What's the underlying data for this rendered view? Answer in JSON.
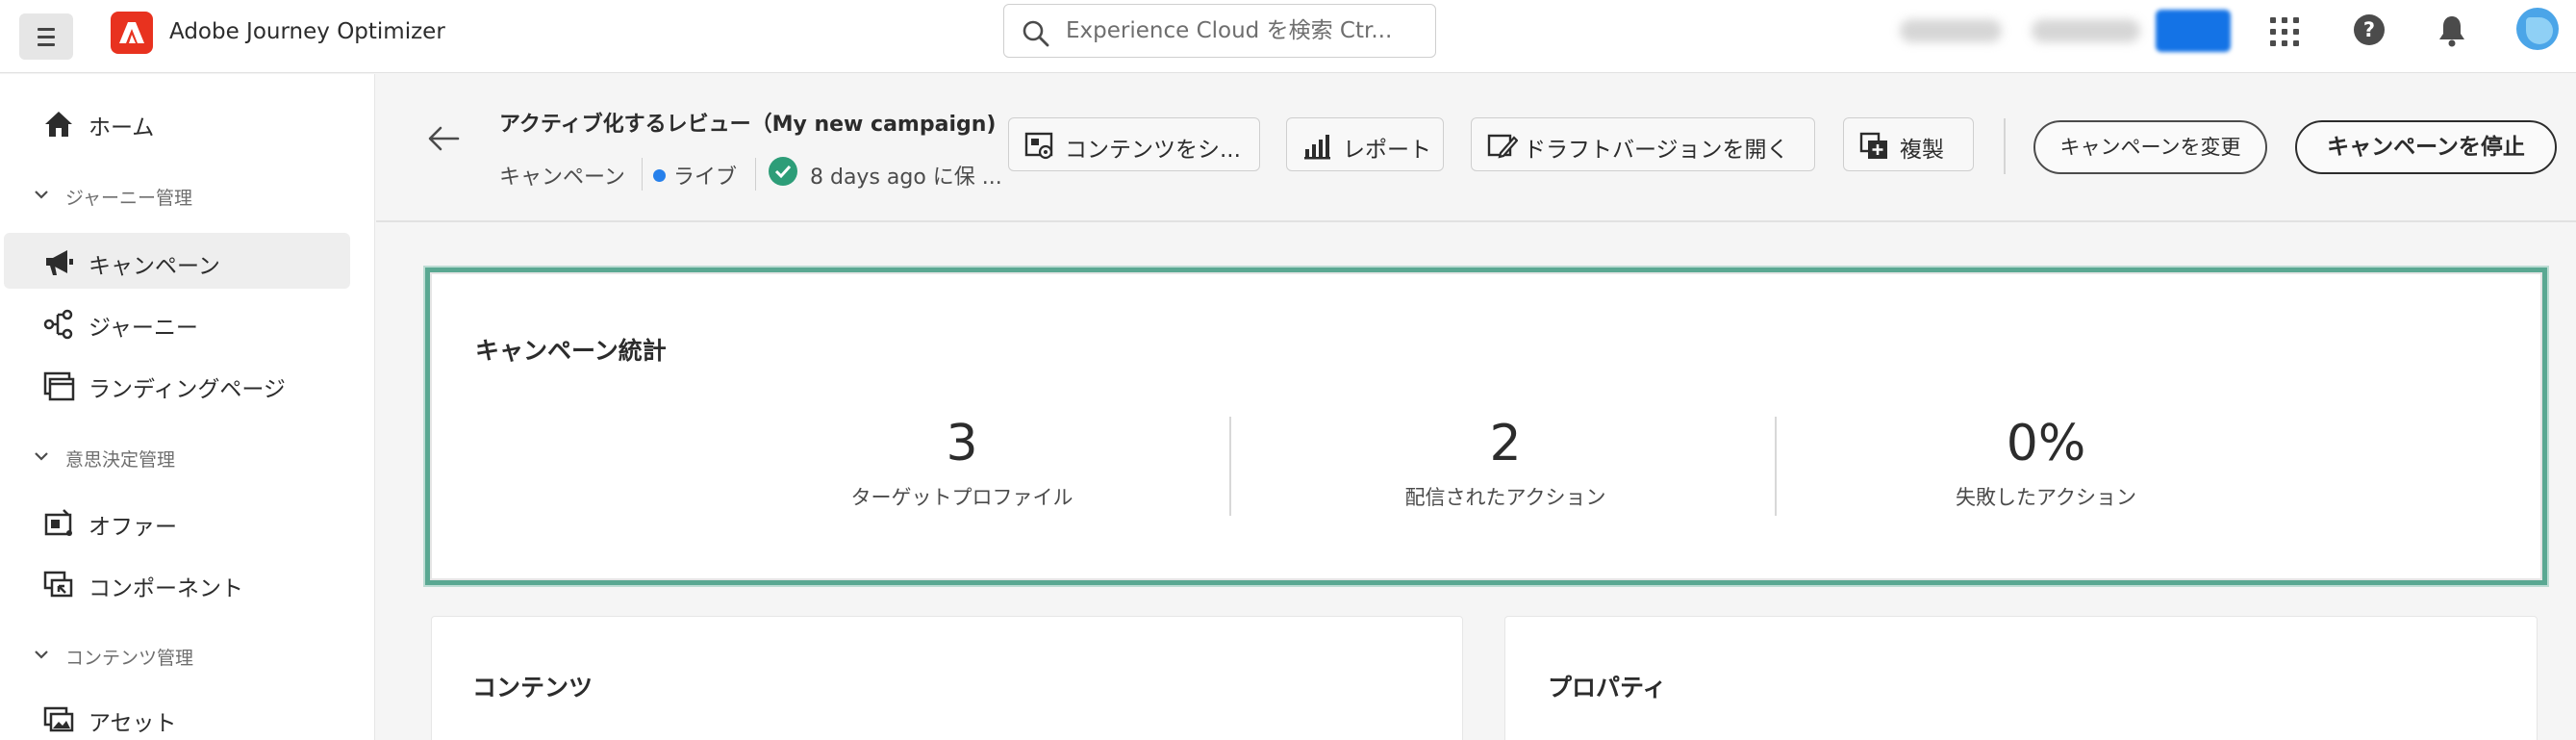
{
  "app": {
    "title": "Adobe Journey Optimizer",
    "search_placeholder": "Experience Cloud を検索 Ctr..."
  },
  "sidebar": {
    "items": [
      {
        "label": "ホーム",
        "icon": "home-icon"
      },
      {
        "group": "ジャーニー管理"
      },
      {
        "label": "キャンペーン",
        "icon": "megaphone-icon",
        "active": true
      },
      {
        "label": "ジャーニー",
        "icon": "journey-icon"
      },
      {
        "label": "ランディングページ",
        "icon": "landing-page-icon"
      },
      {
        "group": "意思決定管理"
      },
      {
        "label": "オファー",
        "icon": "offer-icon"
      },
      {
        "label": "コンポーネント",
        "icon": "component-icon"
      },
      {
        "group": "コンテンツ管理"
      },
      {
        "label": "アセット",
        "icon": "asset-icon"
      }
    ]
  },
  "header": {
    "title": "アクティブ化するレビュー（My new campaign)",
    "type": "キャンペーン",
    "status": "ライブ",
    "saved": "8 days ago に保 ...",
    "buttons": {
      "content": "コンテンツをシ...",
      "report": "レポート",
      "draft": "ドラフトバージョンを開く",
      "duplicate": "複製",
      "modify": "キャンペーンを変更",
      "stop": "キャンペーンを停止"
    }
  },
  "stats": {
    "title": "キャンペーン統計",
    "items": [
      {
        "value": "3",
        "label": "ターゲットプロファイル"
      },
      {
        "value": "2",
        "label": "配信されたアクション"
      },
      {
        "value": "0%",
        "label": "失敗したアクション"
      }
    ]
  },
  "cards": {
    "content_title": "コンテンツ",
    "properties_title": "プロパティ"
  },
  "colors": {
    "accent": "#1473e6",
    "live_dot": "#2680eb",
    "saved_check": "#2d9d78",
    "highlight_border": "#5aa892",
    "brand": "#e8321f"
  }
}
